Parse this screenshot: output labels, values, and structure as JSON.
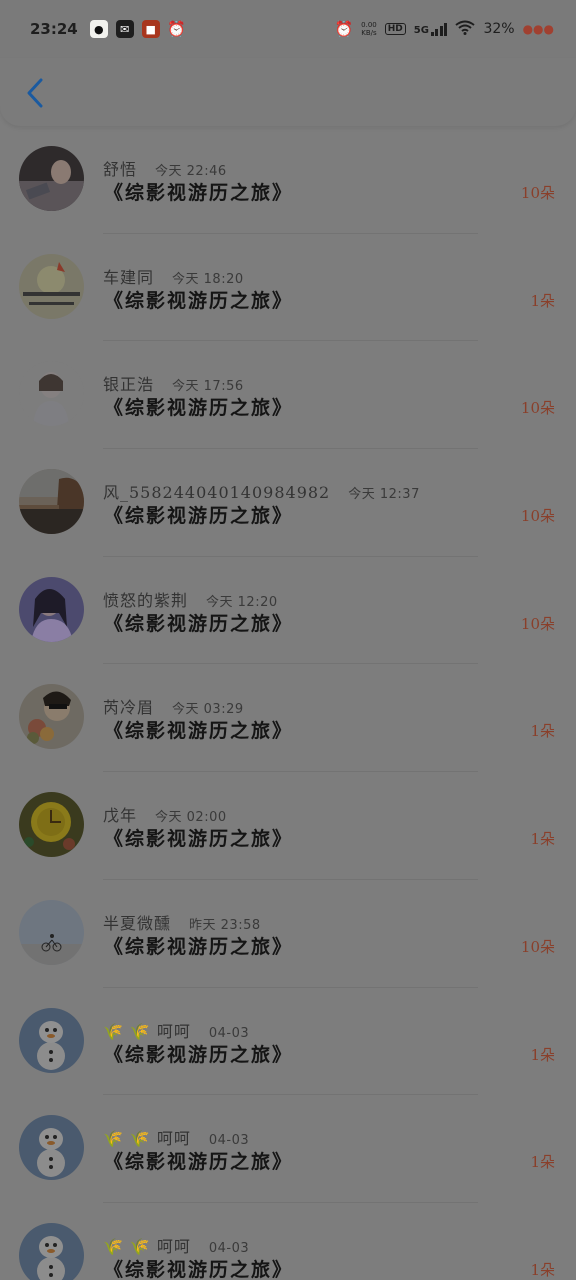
{
  "status_bar": {
    "time": "23:24",
    "net_speed_value": "0.00",
    "net_speed_unit": "KB/s",
    "hd": "HD",
    "network": "5G",
    "battery": "32%"
  },
  "header": {
    "back_icon": "chevron-left-icon"
  },
  "gift_records": [
    {
      "name": "舒悟",
      "time": "今天 22:46",
      "book": "《综影视游历之旅》",
      "amount": "10朵",
      "avatar": "photo-dark"
    },
    {
      "name": "车建同",
      "time": "今天 18:20",
      "book": "《综影视游历之旅》",
      "amount": "1朵",
      "avatar": "cartoon-yellow"
    },
    {
      "name": "银正浩",
      "time": "今天 17:56",
      "book": "《综影视游历之旅》",
      "amount": "10朵",
      "avatar": "sketch-girl"
    },
    {
      "name": "风_558244040140984982",
      "time": "今天 12:37",
      "book": "《综影视游历之旅》",
      "amount": "10朵",
      "avatar": "landscape"
    },
    {
      "name": "愤怒的紫荆",
      "time": "今天 12:20",
      "book": "《综影视游历之旅》",
      "amount": "10朵",
      "avatar": "woman-purple"
    },
    {
      "name": "芮冷眉",
      "time": "今天 03:29",
      "book": "《综影视游历之旅》",
      "amount": "1朵",
      "avatar": "boy-flowers"
    },
    {
      "name": "戊年",
      "time": "今天 02:00",
      "book": "《综影视游历之旅》",
      "amount": "1朵",
      "avatar": "clock-yellow"
    },
    {
      "name": "半夏微醺",
      "time": "昨天 23:58",
      "book": "《综影视游历之旅》",
      "amount": "10朵",
      "avatar": "sky-bike"
    },
    {
      "name": "呵呵",
      "time": "04-03",
      "book": "《综影视游历之旅》",
      "amount": "1朵",
      "avatar": "snowman",
      "leaves": true
    },
    {
      "name": "呵呵",
      "time": "04-03",
      "book": "《综影视游历之旅》",
      "amount": "1朵",
      "avatar": "snowman",
      "leaves": true
    },
    {
      "name": "呵呵",
      "time": "04-03",
      "book": "《综影视游历之旅》",
      "amount": "1朵",
      "avatar": "snowman",
      "leaves": true
    }
  ],
  "colors": {
    "overlay_bg": "#7d7d7d",
    "amount": "#8a3f2a",
    "back_icon": "#1a5aa0"
  }
}
